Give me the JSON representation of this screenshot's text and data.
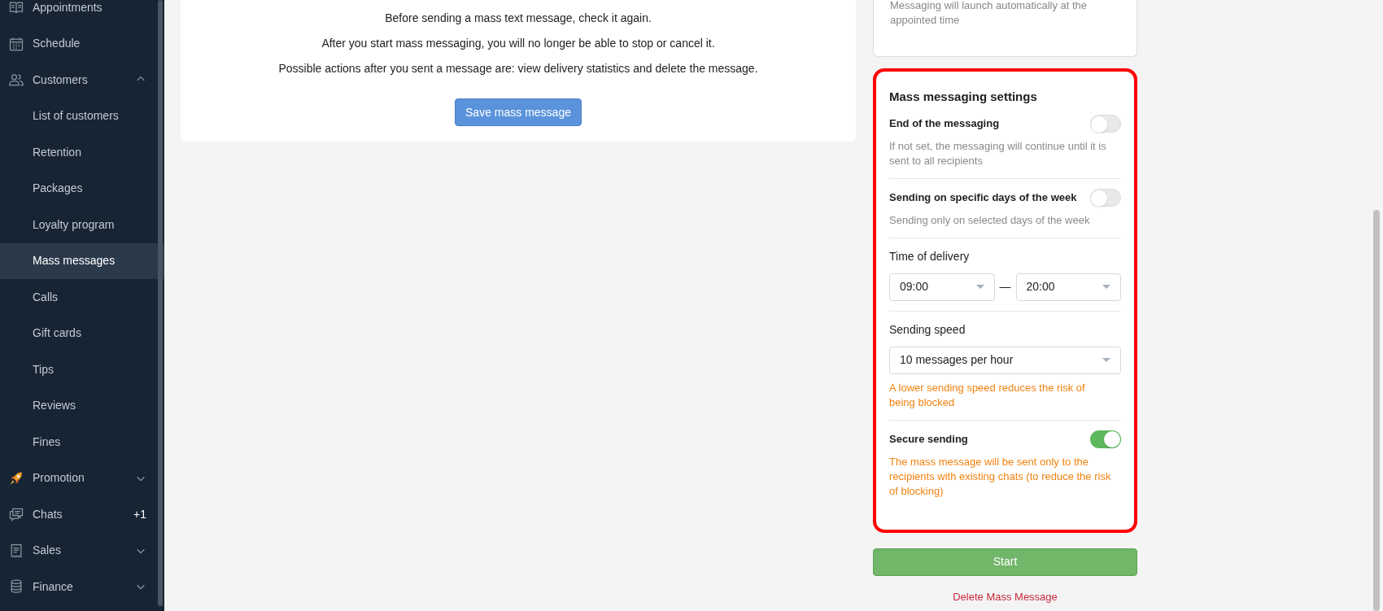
{
  "sidebar": {
    "items": [
      {
        "label": "Appointments",
        "kind": "link",
        "selected": false
      },
      {
        "label": "Schedule",
        "kind": "link",
        "selected": false
      },
      {
        "label": "Customers",
        "kind": "group",
        "expanded": true,
        "selected": false,
        "children": [
          {
            "label": "List of customers",
            "selected": false
          },
          {
            "label": "Retention",
            "selected": false
          },
          {
            "label": "Packages",
            "selected": false
          },
          {
            "label": "Loyalty program",
            "selected": false
          },
          {
            "label": "Mass messages",
            "selected": true
          },
          {
            "label": "Calls",
            "selected": false
          },
          {
            "label": "Gift cards",
            "selected": false
          },
          {
            "label": "Tips",
            "selected": false
          },
          {
            "label": "Reviews",
            "selected": false
          },
          {
            "label": "Fines",
            "selected": false
          }
        ]
      },
      {
        "label": "Promotion",
        "kind": "group",
        "expanded": false,
        "selected": false
      },
      {
        "label": "Chats",
        "kind": "link",
        "selected": false,
        "badge": "+1"
      },
      {
        "label": "Sales",
        "kind": "group",
        "expanded": false,
        "selected": false
      },
      {
        "label": "Finance",
        "kind": "group",
        "expanded": false,
        "selected": false
      }
    ]
  },
  "main": {
    "notes": [
      "Before sending a mass text message, check it again.",
      "After you start mass messaging, you will no longer be able to stop or cancel it.",
      "Possible actions after you sent a message are: view delivery statistics and delete the message."
    ],
    "save_button": "Save mass message"
  },
  "schedule_card": {
    "hint": "Messaging will launch automatically at the appointed time"
  },
  "settings": {
    "title": "Mass messaging settings",
    "highlighted": true,
    "sections": [
      {
        "kind": "toggle",
        "label": "End of the messaging",
        "on": false,
        "hint": "If not set, the messaging will continue until it is sent to all recipients",
        "warning": false
      },
      {
        "kind": "toggle",
        "label": "Sending on specific days of the week",
        "on": false,
        "hint": "Sending only on selected days of the week",
        "warning": false
      },
      {
        "kind": "time_range",
        "label": "Time of delivery",
        "from": "09:00",
        "separator": "—",
        "to": "20:00"
      },
      {
        "kind": "select",
        "label": "Sending speed",
        "value": "10 messages per hour",
        "hint": "A lower sending speed reduces the risk of being blocked",
        "warning": true
      },
      {
        "kind": "toggle",
        "label": "Secure sending",
        "on": true,
        "hint": "The mass message will be sent only to the recipients with existing chats (to reduce the risk of blocking)",
        "warning": true
      }
    ]
  },
  "start_button": "Start",
  "delete_link": "Delete Mass Message"
}
